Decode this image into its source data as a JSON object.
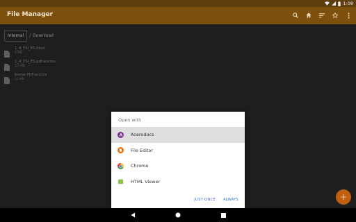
{
  "status_bar": {
    "time": "1:08",
    "icons": [
      "wifi-icon",
      "signal-icon",
      "battery-icon"
    ]
  },
  "app_bar": {
    "title": "File Manager",
    "actions": [
      "search-icon",
      "home-icon",
      "sort-icon",
      "star-icon",
      "more-vert-icon"
    ]
  },
  "breadcrumb": {
    "root": "Internal",
    "separator": "/",
    "current": "Download"
  },
  "files": [
    {
      "name": "1_4_TSI_ES.html",
      "size": "4 MB"
    },
    {
      "name": "1_4_TSI_ES.pdf.acerov",
      "size": "5.5 MB"
    },
    {
      "name": "borrar.PDF.acerov",
      "size": "22 MB"
    }
  ],
  "dialog": {
    "title": "Open with",
    "options": [
      {
        "label": "Acerodocs",
        "icon": "acerodocs-icon",
        "selected": true
      },
      {
        "label": "File Editor",
        "icon": "file-editor-icon",
        "selected": false
      },
      {
        "label": "Chrome",
        "icon": "chrome-icon",
        "selected": false
      },
      {
        "label": "HTML Viewer",
        "icon": "html-viewer-icon",
        "selected": false
      }
    ],
    "just_once": "JUST ONCE",
    "always": "ALWAYS"
  },
  "fab": {
    "icon": "add-icon",
    "symbol": "+"
  },
  "nav_bar": {
    "buttons": [
      "back-icon",
      "home-circle-icon",
      "recents-icon"
    ]
  },
  "colors": {
    "status_bar": "#5e3e0f",
    "app_bar": "#7d500e",
    "background": "#1e1e1e",
    "fab": "#c15f10",
    "accent_blue": "#3d6fd6",
    "selected_row": "#dedede"
  }
}
